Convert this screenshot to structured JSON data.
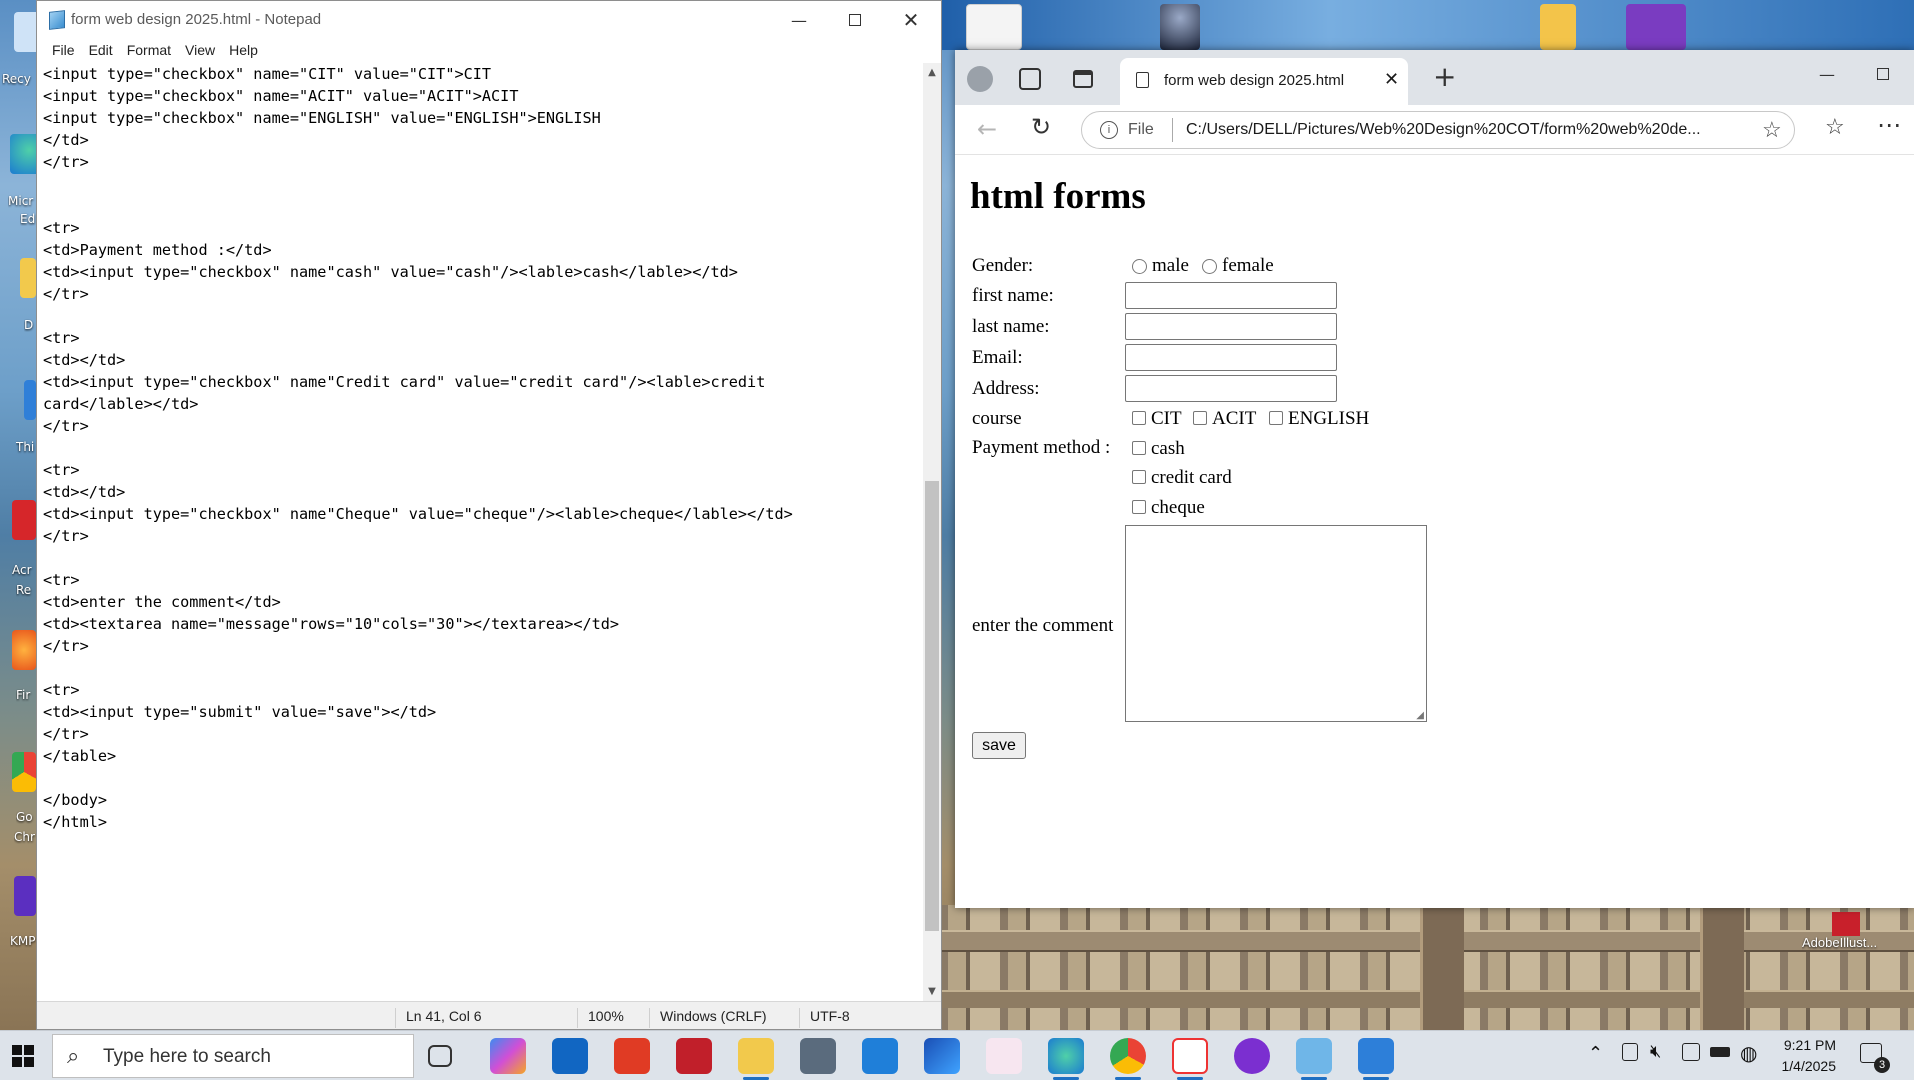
{
  "desktop": {
    "left_labels": [
      "Recy",
      "Micr",
      "Ed",
      "D",
      "Thi",
      "Acr",
      "Re",
      "Fir",
      "Go",
      "Chr",
      "KMP"
    ],
    "right_label": "AdobeIllust..."
  },
  "notepad": {
    "title": "form web design 2025.html - Notepad",
    "menu": [
      "File",
      "Edit",
      "Format",
      "View",
      "Help"
    ],
    "lines": [
      "<input type=\"checkbox\" name=\"CIT\" value=\"CIT\">CIT",
      "<input type=\"checkbox\" name=\"ACIT\" value=\"ACIT\">ACIT",
      "<input type=\"checkbox\" name=\"ENGLISH\" value=\"ENGLISH\">ENGLISH",
      "</td>",
      "</tr>",
      "",
      "",
      "<tr>",
      "<td>Payment method :</td>",
      "<td><input type=\"checkbox\" name\"cash\" value=\"cash\"/><lable>cash</lable></td>",
      "</tr>",
      "",
      "<tr>",
      "<td></td>",
      "<td><input type=\"checkbox\" name\"Credit card\" value=\"credit card\"/><lable>credit",
      "card</lable></td>",
      "</tr>",
      "",
      "<tr>",
      "<td></td>",
      "<td><input type=\"checkbox\" name\"Cheque\" value=\"cheque\"/><lable>cheque</lable></td>",
      "</tr>",
      "",
      "<tr>",
      "<td>enter the comment</td>",
      "<td><textarea name=\"message\"rows=\"10\"cols=\"30\"></textarea></td>",
      "</tr>",
      "",
      "<tr>",
      "<td><input type=\"submit\" value=\"save\"></td>",
      "</tr>",
      "</table>",
      "",
      "</body>",
      "</html>"
    ],
    "status": {
      "position": "Ln 41, Col 6",
      "zoom": "100%",
      "line_endings": "Windows (CRLF)",
      "encoding": "UTF-8"
    }
  },
  "browser": {
    "tab_title": "form web design 2025.html",
    "address_prefix": "File",
    "address": "C:/Users/DELL/Pictures/Web%20Design%20COT/form%20web%20de...",
    "page": {
      "heading": "html forms",
      "gender_label": "Gender:",
      "gender_options": [
        "male",
        "female"
      ],
      "first_name_label": "first name:",
      "last_name_label": "last name:",
      "email_label": "Email:",
      "address_label": "Address:",
      "course_label": "course",
      "course_options": [
        "CIT",
        "ACIT",
        "ENGLISH"
      ],
      "payment_label": "Payment method :",
      "payment_options": [
        "cash",
        "credit card",
        "cheque"
      ],
      "comment_label": "enter the comment",
      "submit_label": "save"
    }
  },
  "taskbar": {
    "search_placeholder": "Type here to search",
    "time": "9:21 PM",
    "date": "1/4/2025",
    "notification_count": "3"
  }
}
